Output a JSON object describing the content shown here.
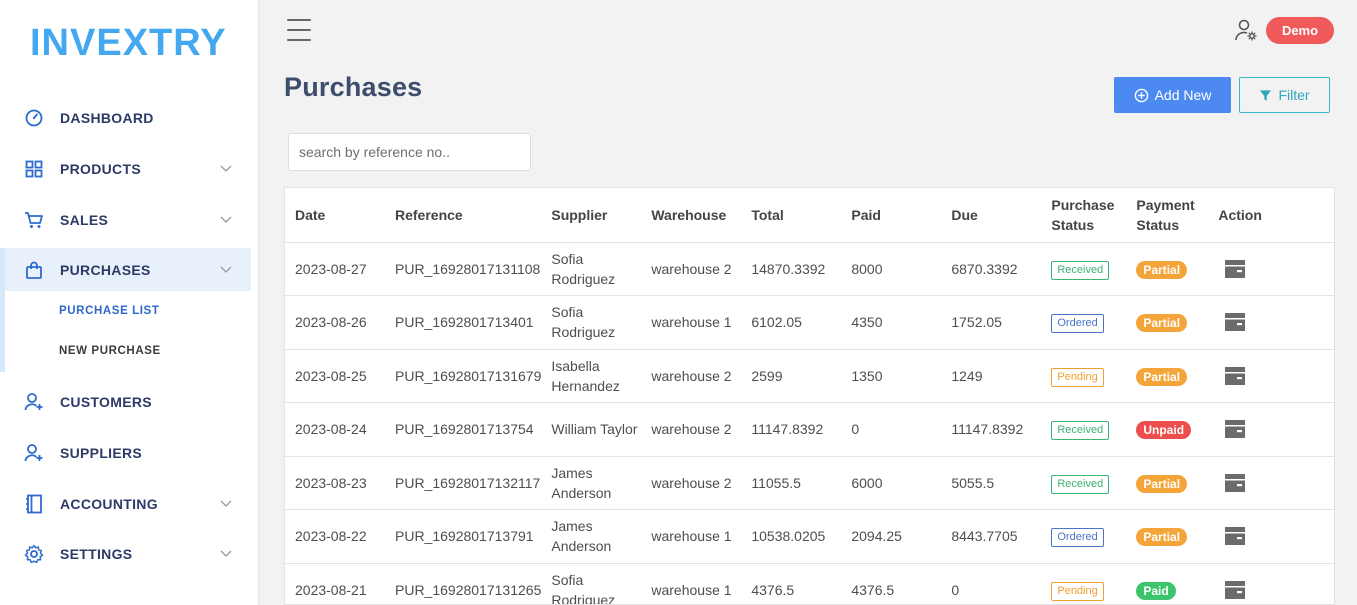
{
  "brand": "INVEXTRY",
  "nav": [
    {
      "label": "DASHBOARD",
      "icon": "dashboard-icon"
    },
    {
      "label": "PRODUCTS",
      "icon": "grid-icon"
    },
    {
      "label": "SALES",
      "icon": "cart-icon"
    },
    {
      "label": "PURCHASES",
      "icon": "bag-icon"
    },
    {
      "label": "CUSTOMERS",
      "icon": "user-plus-icon"
    },
    {
      "label": "SUPPLIERS",
      "icon": "user-plus-icon"
    },
    {
      "label": "ACCOUNTING",
      "icon": "book-icon"
    },
    {
      "label": "SETTINGS",
      "icon": "gear-icon"
    }
  ],
  "submenu": {
    "purchase_list": "PURCHASE LIST",
    "new_purchase": "NEW PURCHASE"
  },
  "header": {
    "user_badge": "Demo"
  },
  "page": {
    "title": "Purchases",
    "add_new": "Add New",
    "filter": "Filter"
  },
  "search": {
    "placeholder": "search by reference no.."
  },
  "table": {
    "headers": [
      "Date",
      "Reference",
      "Supplier",
      "Warehouse",
      "Total",
      "Paid",
      "Due",
      "Purchase Status",
      "Payment Status",
      "Action"
    ],
    "rows": [
      {
        "date": "2023-08-27",
        "ref": "PUR_16928017131108",
        "supplier": "Sofia Rodriguez",
        "warehouse": "warehouse 2",
        "total": "14870.3392",
        "paid": "8000",
        "due": "6870.3392",
        "status": "Received",
        "payment": "Partial"
      },
      {
        "date": "2023-08-26",
        "ref": "PUR_1692801713401",
        "supplier": "Sofia Rodriguez",
        "warehouse": "warehouse 1",
        "total": "6102.05",
        "paid": "4350",
        "due": "1752.05",
        "status": "Ordered",
        "payment": "Partial"
      },
      {
        "date": "2023-08-25",
        "ref": "PUR_16928017131679",
        "supplier": "Isabella Hernandez",
        "warehouse": "warehouse 2",
        "total": "2599",
        "paid": "1350",
        "due": "1249",
        "status": "Pending",
        "payment": "Partial"
      },
      {
        "date": "2023-08-24",
        "ref": "PUR_1692801713754",
        "supplier": "William Taylor",
        "warehouse": "warehouse 2",
        "total": "11147.8392",
        "paid": "0",
        "due": "11147.8392",
        "status": "Received",
        "payment": "Unpaid"
      },
      {
        "date": "2023-08-23",
        "ref": "PUR_16928017132117",
        "supplier": "James Anderson",
        "warehouse": "warehouse 2",
        "total": "11055.5",
        "paid": "6000",
        "due": "5055.5",
        "status": "Received",
        "payment": "Partial"
      },
      {
        "date": "2023-08-22",
        "ref": "PUR_1692801713791",
        "supplier": "James Anderson",
        "warehouse": "warehouse 1",
        "total": "10538.0205",
        "paid": "2094.25",
        "due": "8443.7705",
        "status": "Ordered",
        "payment": "Partial"
      },
      {
        "date": "2023-08-21",
        "ref": "PUR_16928017131265",
        "supplier": "Sofia Rodriguez",
        "warehouse": "warehouse 1",
        "total": "4376.5",
        "paid": "4376.5",
        "due": "0",
        "status": "Pending",
        "payment": "Paid"
      }
    ]
  },
  "colors": {
    "brand": "#44a8f1",
    "received": "#3cb371",
    "ordered": "#4a74c9",
    "pending": "#f0a030",
    "partial": "#f4a53a",
    "unpaid": "#ec4d4d",
    "paid": "#3ec46d",
    "primary_button": "#4c8af2",
    "demo_badge": "#f05a5a"
  }
}
